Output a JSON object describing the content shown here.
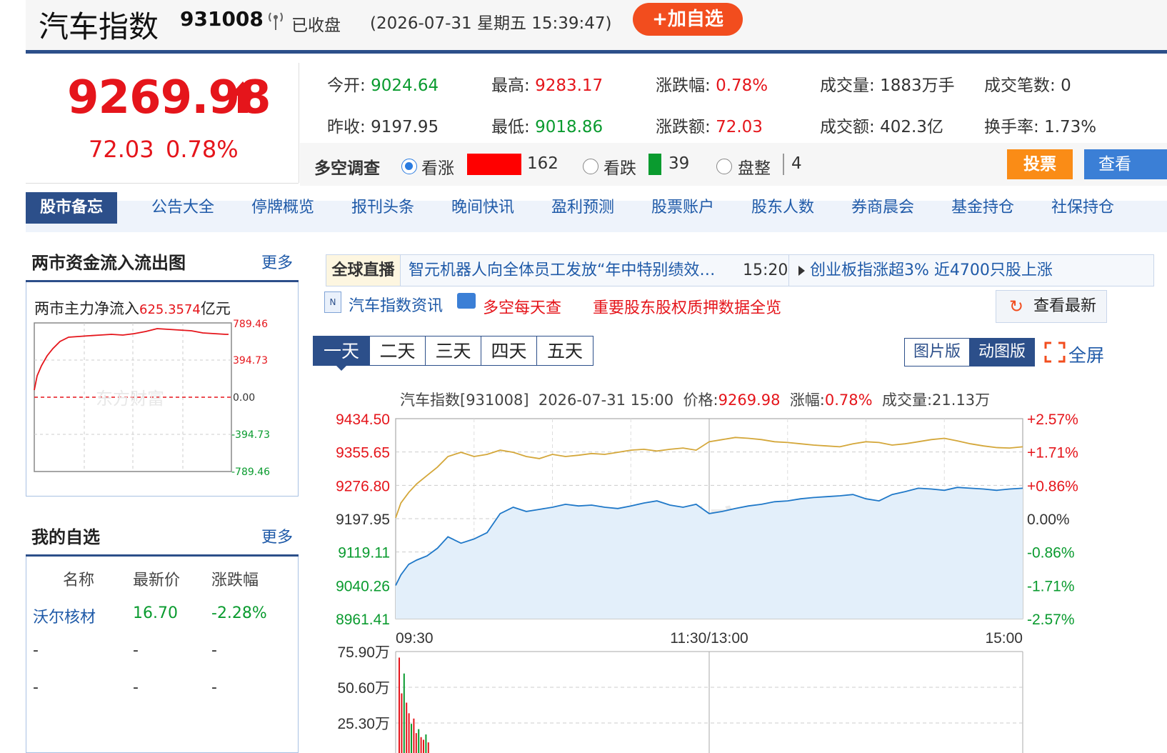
{
  "header": {
    "title": "汽车指数",
    "code": "931008",
    "status": "已收盘",
    "datetime": "(2026-07-31 星期五 15:39:47)",
    "add_button": "+加自选"
  },
  "quote": {
    "price": "9269.98",
    "change": "72.03",
    "change_pct": "0.78%"
  },
  "stats": {
    "open_label": "今开:",
    "open": "9024.64",
    "high_label": "最高:",
    "high": "9283.17",
    "chg_pct_label": "涨跌幅:",
    "chg_pct": "0.78%",
    "volume_label": "成交量:",
    "volume": "1883万手",
    "trades_label": "成交笔数:",
    "trades": "0",
    "prev_label": "昨收:",
    "prev": "9197.95",
    "low_label": "最低:",
    "low": "9018.86",
    "chg_amt_label": "涨跌额:",
    "chg_amt": "72.03",
    "amount_label": "成交额:",
    "amount": "402.3亿",
    "turnover_label": "换手率:",
    "turnover": "1.73%"
  },
  "survey": {
    "label": "多空调查",
    "up_label": "看涨",
    "up_count": "162",
    "down_label": "看跌",
    "down_count": "39",
    "flat_label": "盘整",
    "flat_count": "4",
    "vote_button": "投票",
    "check_button": "查看",
    "colors": {
      "up": "#ff0000",
      "down": "#0a9b2f",
      "flat": "#999999"
    }
  },
  "nav": {
    "active": "股市备忘",
    "items": [
      "公告大全",
      "停牌概览",
      "报刊头条",
      "晚间快讯",
      "盈利预测",
      "股票账户",
      "股东人数",
      "券商晨会",
      "基金持仓",
      "社保持仓"
    ]
  },
  "fund_flow": {
    "title": "两市资金流入流出图",
    "more": "更多",
    "label": "两市主力净流入",
    "value": "625.3574",
    "unit": "亿元",
    "ticks": [
      "789.46",
      "394.73",
      "0.00",
      "-394.73",
      "-789.46"
    ],
    "watermark": "东方财富"
  },
  "watchlist": {
    "title": "我的自选",
    "more": "更多",
    "headers": [
      "名称",
      "最新价",
      "涨跌幅"
    ],
    "rows": [
      [
        "沃尔核材",
        "16.70",
        "-2.28%"
      ],
      [
        "-",
        "-",
        "-"
      ],
      [
        "-",
        "-",
        "-"
      ]
    ]
  },
  "live": {
    "label": "全球直播",
    "headline": "智元机器人向全体员工发放“年中特别绩效…",
    "time": "15:20",
    "headline2": "创业板指涨超3% 近4700只股上涨"
  },
  "links": {
    "news": "汽车指数资讯",
    "daily": "多空每天查",
    "pledge": "重要股东股权质押数据全览",
    "refresh": "查看最新"
  },
  "chart_tabs": [
    "一天",
    "二天",
    "三天",
    "四天",
    "五天"
  ],
  "chart_modes": [
    "图片版",
    "动图版"
  ],
  "fullscreen": "全屏",
  "chart_header": {
    "name": "汽车指数[931008]",
    "time": "2026-07-31 15:00",
    "price_label": "价格:",
    "price": "9269.98",
    "pct_label": "涨幅:",
    "pct": "0.78%",
    "vol_label": "成交量:",
    "vol": "21.13万"
  },
  "watermark": "东方财富",
  "chart_data": {
    "type": "line",
    "title": "汽车指数[931008]",
    "x_ticks": [
      "09:30",
      "11:30/13:00",
      "15:00"
    ],
    "y_left_ticks": [
      "9434.50",
      "9355.65",
      "9276.80",
      "9197.95",
      "9119.11",
      "9040.26",
      "8961.41"
    ],
    "y_right_ticks": [
      "+2.57%",
      "+1.71%",
      "+0.86%",
      "0.00%",
      "-0.86%",
      "-1.71%",
      "-2.57%"
    ],
    "ylim": [
      8961.41,
      9434.5
    ],
    "baseline": 9197.95,
    "x_domain": [
      0,
      240
    ],
    "series": [
      {
        "color": "#1f78c8",
        "x": [
          0,
          2,
          5,
          8,
          12,
          16,
          20,
          25,
          30,
          35,
          40,
          45,
          50,
          55,
          60,
          65,
          70,
          75,
          80,
          85,
          90,
          95,
          100,
          105,
          110,
          115,
          120,
          125,
          130,
          135,
          140,
          145,
          150,
          155,
          160,
          165,
          170,
          175,
          180,
          185,
          190,
          195,
          200,
          205,
          210,
          215,
          220,
          225,
          230,
          235,
          240
        ],
        "values": [
          9040,
          9065,
          9090,
          9100,
          9110,
          9128,
          9155,
          9140,
          9150,
          9165,
          9210,
          9225,
          9215,
          9220,
          9225,
          9232,
          9228,
          9230,
          9225,
          9222,
          9228,
          9235,
          9240,
          9230,
          9225,
          9232,
          9210,
          9215,
          9222,
          9228,
          9232,
          9238,
          9240,
          9245,
          9248,
          9250,
          9252,
          9255,
          9245,
          9240,
          9255,
          9262,
          9270,
          9268,
          9265,
          9272,
          9270,
          9268,
          9265,
          9268,
          9270
        ]
      },
      {
        "color": "#d4a73a",
        "x": [
          0,
          2,
          5,
          8,
          12,
          16,
          20,
          25,
          30,
          35,
          40,
          45,
          50,
          55,
          60,
          65,
          70,
          75,
          80,
          85,
          90,
          95,
          100,
          105,
          110,
          115,
          120,
          125,
          130,
          135,
          140,
          145,
          150,
          155,
          160,
          165,
          170,
          175,
          180,
          185,
          190,
          195,
          200,
          205,
          210,
          215,
          220,
          225,
          230,
          235,
          240
        ],
        "values": [
          9200,
          9235,
          9260,
          9280,
          9300,
          9320,
          9345,
          9355,
          9345,
          9350,
          9360,
          9355,
          9345,
          9340,
          9350,
          9345,
          9348,
          9352,
          9350,
          9355,
          9360,
          9362,
          9358,
          9362,
          9365,
          9360,
          9380,
          9385,
          9390,
          9388,
          9385,
          9380,
          9378,
          9375,
          9372,
          9370,
          9368,
          9375,
          9380,
          9378,
          9372,
          9375,
          9380,
          9385,
          9388,
          9382,
          9375,
          9370,
          9366,
          9365,
          9368
        ]
      }
    ],
    "volume": {
      "ylim": [
        0,
        75.9
      ],
      "y_ticks": [
        "75.90万",
        "50.60万",
        "25.30万"
      ],
      "x": [
        0,
        1,
        2,
        3,
        4,
        5,
        6,
        7,
        8,
        9,
        10,
        11,
        12
      ],
      "values": [
        72,
        45,
        60,
        38,
        30,
        22,
        26,
        15,
        18,
        12,
        10,
        14,
        8
      ]
    }
  }
}
